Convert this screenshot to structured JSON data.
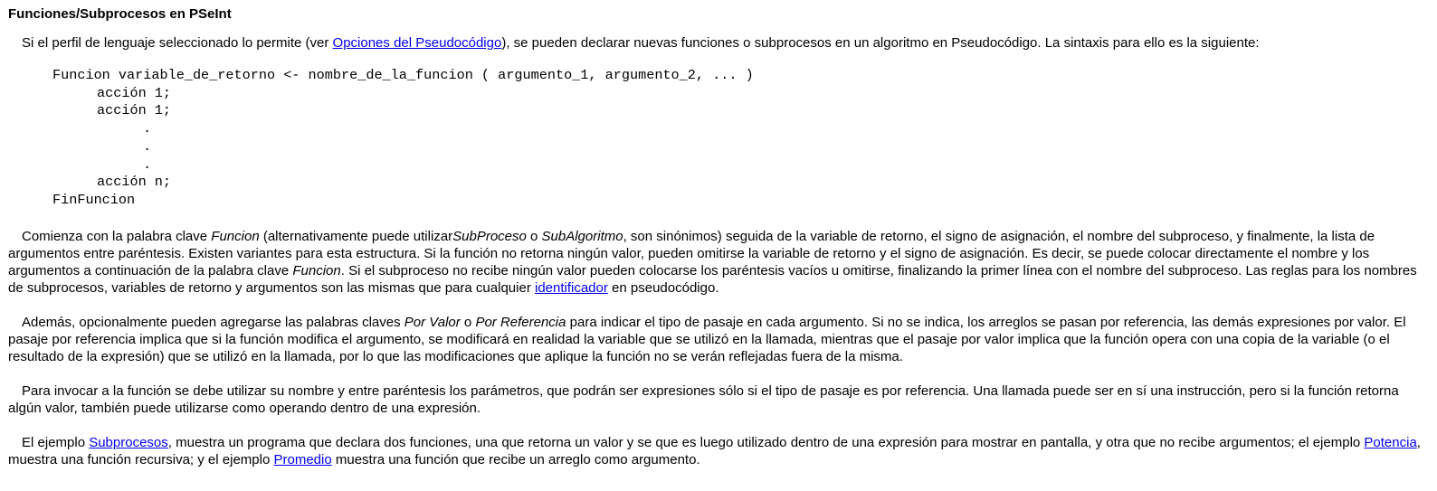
{
  "title": "Funciones/Subprocesos en PSeInt",
  "intro": {
    "before_link": "Si el perfil de lenguaje seleccionado lo permite (ver ",
    "link": "Opciones del Pseudocódigo",
    "after_link": "), se pueden declarar nuevas funciones o subprocesos en un algoritmo en Pseudocódigo. La sintaxis para ello es la siguiente:"
  },
  "code": {
    "header": "Funcion variable_de_retorno <- nombre_de_la_funcion ( argumento_1, argumento_2, ... )",
    "line1": "acción 1;",
    "line2": "acción 1;",
    "dot1": ".",
    "dot2": ".",
    "dot3": ".",
    "line_n": "acción n;",
    "footer": "FinFuncion"
  },
  "para1": {
    "t1": "Comienza con la palabra clave ",
    "em1": "Funcion",
    "t2": " (alternativamente puede utilizar",
    "em2": "SubProceso",
    "t3": " o ",
    "em3": "SubAlgoritmo",
    "t4": ", son sinónimos) seguida de la variable de retorno, el signo de asignación, el nombre del subproceso, y finalmente, la lista de argumentos entre paréntesis. Existen variantes para esta estructura. Si la función no retorna ningún valor, pueden omitirse la variable de retorno y el signo de asignación. Es decir, se puede colocar directamente el nombre y los argumentos a continuación de la palabra clave ",
    "em4": "Funcion",
    "t5": ". Si el subproceso no recibe ningún valor pueden colocarse los paréntesis vacíos u omitirse, finalizando la primer línea con el nombre del subproceso. Las reglas para los nombres de subprocesos, variables de retorno y argumentos son las mismas que para cualquier ",
    "link": "identificador",
    "t6": " en pseudocódigo."
  },
  "para2": {
    "t1": "Además, opcionalmente pueden agregarse las palabras claves ",
    "em1": "Por Valor",
    "t2": " o ",
    "em2": "Por Referencia",
    "t3": " para indicar el tipo de pasaje en cada argumento. Si no se indica, los arreglos se pasan por referencia, las demás expresiones por valor. El pasaje por referencia implica que si la función modifica el argumento, se modificará en realidad la variable que se utilizó en la llamada, mientras que el pasaje por valor implica que la función opera con una copia de la variable (o el resultado de la expresión) que se utilizó en la llamada, por lo que las modificaciones que aplique la función no se verán reflejadas fuera de la misma."
  },
  "para3": {
    "text": "Para invocar a la función se debe utilizar su nombre y entre paréntesis los parámetros, que podrán ser expresiones sólo si el tipo de pasaje es por referencia. Una llamada puede ser en sí una instrucción, pero si la función retorna algún valor, también puede utilizarse como operando dentro de una expresión."
  },
  "para4": {
    "t1": "El ejemplo ",
    "link1": "Subprocesos",
    "t2": ", muestra un programa que declara dos funciones, una que retorna un valor y se que es luego utilizado dentro de una expresión para mostrar en pantalla, y otra que no recibe argumentos; el ejemplo ",
    "link2": "Potencia",
    "t3": ", muestra una función recursiva; y el ejemplo ",
    "link3": "Promedio",
    "t4": " muestra una función que recibe un arreglo como argumento."
  }
}
